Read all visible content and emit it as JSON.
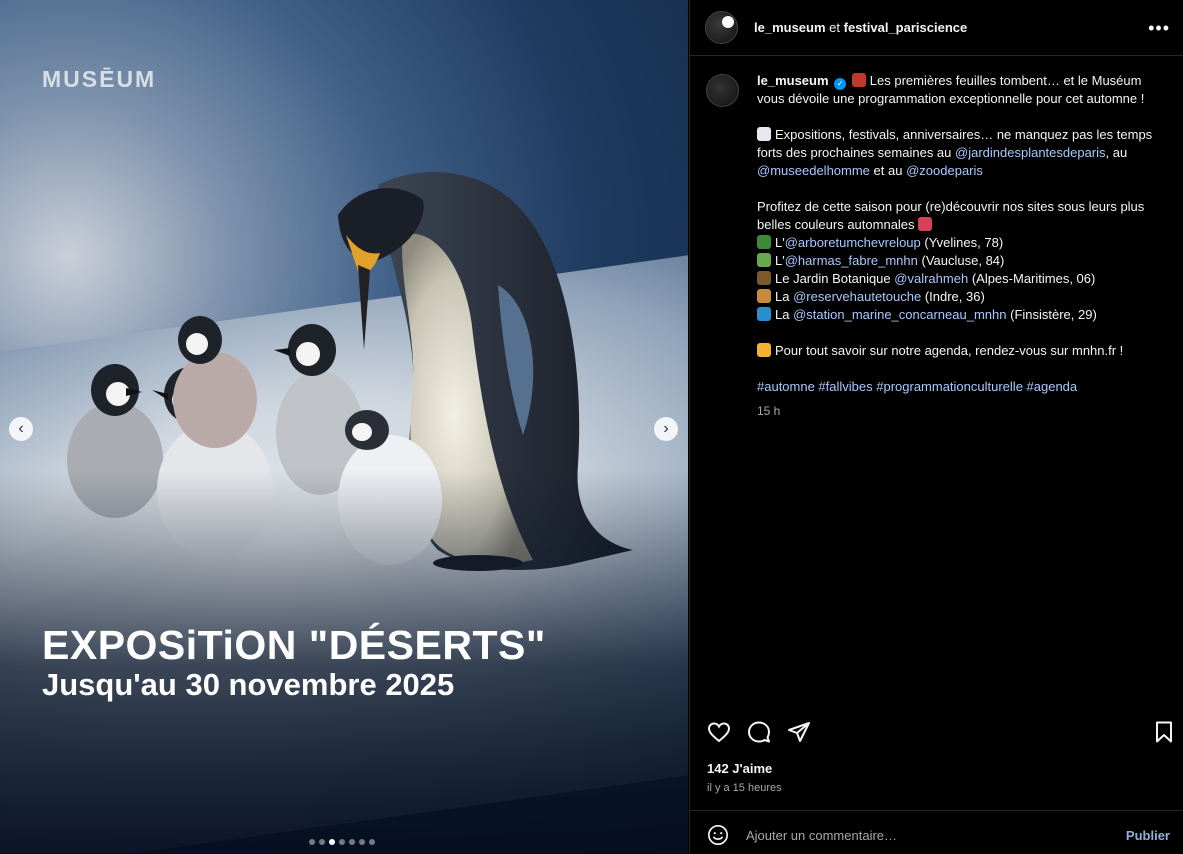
{
  "media": {
    "brand": "MUSĒUM",
    "title": "EXPOSiTiON \"DÉSERTS\"",
    "subtitle": "Jusqu'au 30 novembre 2025",
    "carousel": {
      "count": 7,
      "active_index": 2
    }
  },
  "header": {
    "account": "le_museum",
    "connector": "et",
    "collaborator": "festival_pariscience"
  },
  "caption": {
    "username": "le_museum",
    "line1": "Les premières feuilles tombent… et le Muséum vous dévoile une programmation exceptionnelle pour cet automne !",
    "p2_text": "Expositions, festivals, anniversaires… ne manquez pas les temps forts des prochaines semaines au",
    "p2_link1": "@jardindesplantesdeparis",
    "p2_sep1": ", au",
    "p2_link2": "@museedelhomme",
    "p2_sep2": "et au",
    "p2_link3": "@zoodeparis",
    "p3_text": "Profitez de cette saison pour (re)découvrir nos sites sous leurs plus belles couleurs automnales",
    "sites": [
      {
        "prefix": "L'",
        "link": "@arboretumchevreloup",
        "suffix": "(Yvelines, 78)",
        "emoji_color": "#3c8a3a"
      },
      {
        "prefix": "L'",
        "link": "@harmas_fabre_mnhn",
        "suffix": "(Vaucluse, 84)",
        "emoji_color": "#6aa84f"
      },
      {
        "prefix": "Le Jardin Botanique",
        "link": "@valrahmeh",
        "suffix": "(Alpes-Maritimes, 06)",
        "emoji_color": "#7a5a2b"
      },
      {
        "prefix": "La",
        "link": "@reservehautetouche",
        "suffix": "(Indre, 36)",
        "emoji_color": "#c98a3a"
      },
      {
        "prefix": "La",
        "link": "@station_marine_concarneau_mnhn",
        "suffix": "(Finsistère, 29)",
        "emoji_color": "#2a8fd1"
      }
    ],
    "p4_text": "Pour tout savoir sur notre agenda, rendez-vous sur mnhn.fr !",
    "hashtags": "#automne #fallvibes #programmationculturelle #agenda",
    "time": "15 h"
  },
  "footer": {
    "likes": "142 J'aime",
    "ago": "il y a 15 heures",
    "comment_placeholder": "Ajouter un commentaire…",
    "publish": "Publier"
  },
  "colors": {
    "link": "#a8c7ff",
    "verified": "#0095f6",
    "background": "#000000"
  }
}
